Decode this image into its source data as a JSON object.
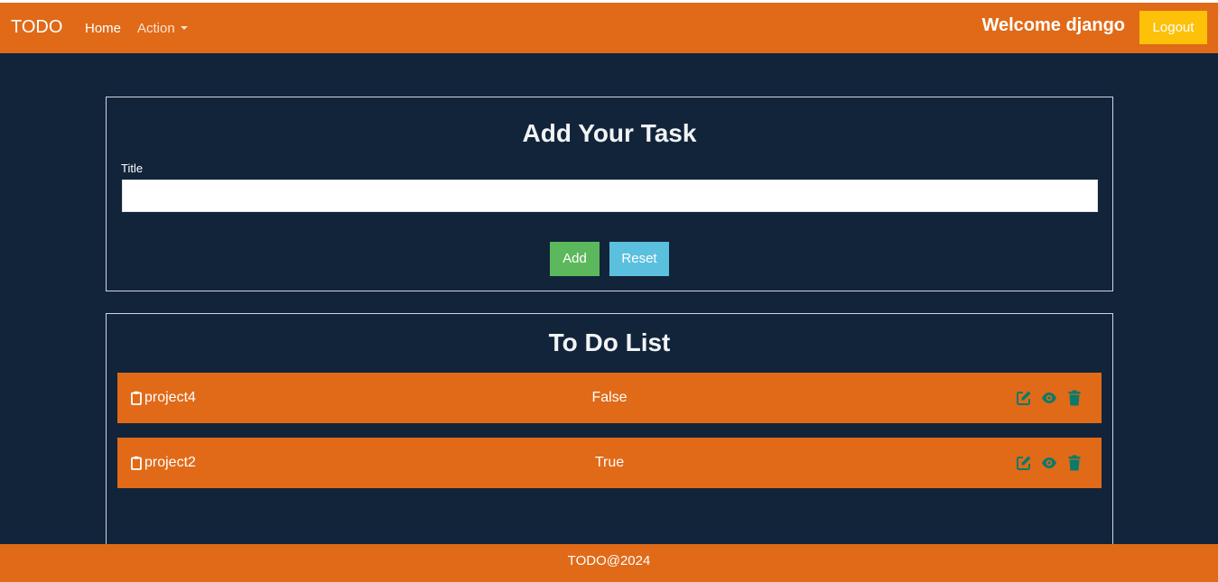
{
  "navbar": {
    "brand": "TODO",
    "home": "Home",
    "action": "Action",
    "welcome": "Welcome django",
    "logout": "Logout"
  },
  "add_task": {
    "heading": "Add Your Task",
    "title_label": "Title",
    "title_value": "",
    "add_label": "Add",
    "reset_label": "Reset"
  },
  "todo_list": {
    "heading": "To Do List",
    "items": [
      {
        "name": "project4",
        "status": "False"
      },
      {
        "name": "project2",
        "status": "True"
      }
    ],
    "action_icons": [
      "edit-icon",
      "eye-icon",
      "trash-icon"
    ]
  },
  "footer": {
    "text": "TODO@2024"
  },
  "colors": {
    "navbar": "#e06a18",
    "background": "#12243a",
    "logout": "#fdc10a",
    "add": "#5cb85c",
    "reset": "#5bc0de",
    "action_icons": "#0b7a6a"
  }
}
